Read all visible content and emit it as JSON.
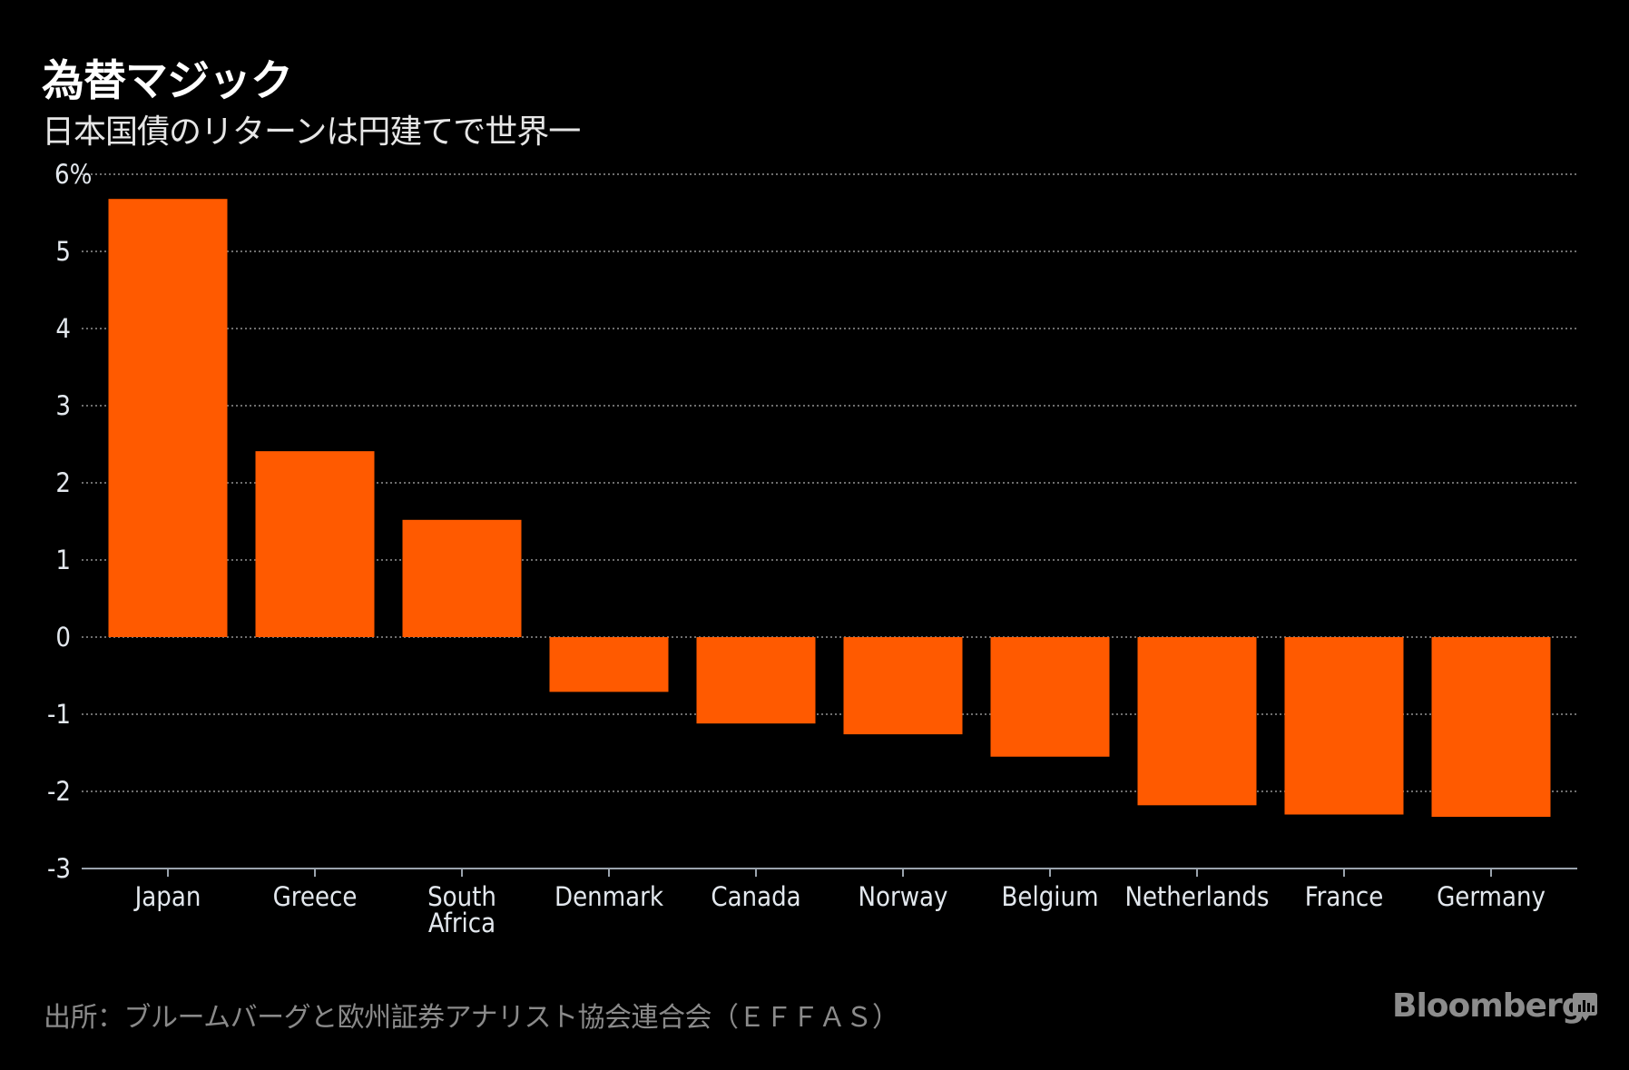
{
  "header": {
    "title": "為替マジック",
    "subtitle": "日本国債のリターンは円建てで世界一"
  },
  "footer": {
    "source": "出所：ブルームバーグと欧州証券アナリスト協会連合会（ＥＦＦＡＳ）",
    "brand": "Bloomberg",
    "brand_icon": "bloomberg-chart-icon"
  },
  "colors": {
    "background": "#000000",
    "bar": "#FF5A00",
    "gridline": "#6e6e6e",
    "axis": "#9aa3ad",
    "text": "#e3e8ee"
  },
  "chart_data": {
    "type": "bar",
    "title": "為替マジック",
    "subtitle": "日本国債のリターンは円建てで世界一",
    "xlabel": "",
    "ylabel": "",
    "categories": [
      "Japan",
      "Greece",
      "South Africa",
      "Denmark",
      "Canada",
      "Norway",
      "Belgium",
      "Netherlands",
      "France",
      "Germany"
    ],
    "category_label_lines": [
      [
        "Japan"
      ],
      [
        "Greece"
      ],
      [
        "South",
        "Africa"
      ],
      [
        "Denmark"
      ],
      [
        "Canada"
      ],
      [
        "Norway"
      ],
      [
        "Belgium"
      ],
      [
        "Netherlands"
      ],
      [
        "France"
      ],
      [
        "Germany"
      ]
    ],
    "values": [
      5.68,
      2.41,
      1.52,
      -0.71,
      -1.12,
      -1.26,
      -1.55,
      -2.18,
      -2.3,
      -2.33
    ],
    "ylim": [
      -3,
      6
    ],
    "yticks": [
      6,
      5,
      4,
      3,
      2,
      1,
      0,
      -1,
      -2,
      -3
    ],
    "ytick_labels": [
      "6%",
      "5",
      "4",
      "3",
      "2",
      "1",
      "0",
      "-1",
      "-2",
      "-3"
    ],
    "grid": true,
    "legend": "none",
    "source": "出所：ブルームバーグと欧州証券アナリスト協会連合会（ＥＦＦＡＳ）"
  }
}
